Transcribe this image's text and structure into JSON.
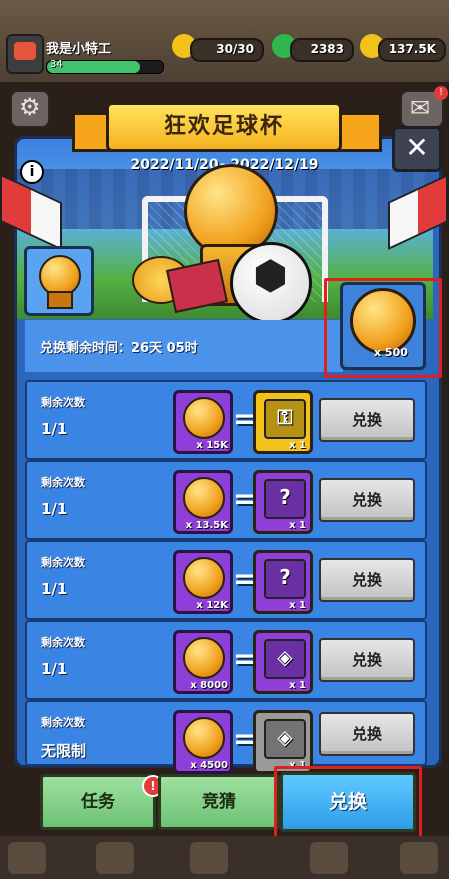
{
  "player": {
    "name": "我是小特工",
    "level": "34",
    "level_progress": 0.8
  },
  "resources": [
    {
      "name": "energy-icon",
      "color": "#f2c21b",
      "value": "30/30"
    },
    {
      "name": "gem-icon",
      "color": "#2fb84c",
      "value": "2383"
    },
    {
      "name": "coin-icon",
      "color": "#f2c21b",
      "value": "137.5K"
    }
  ],
  "mail_badge": "!",
  "event": {
    "title": "狂欢足球杯",
    "dates": "2022/11/20~2022/12/19",
    "info_icon": "i",
    "close_label": "✕",
    "remaining_time": "兑换剩余时间：26天 05时",
    "owned_quantity": "x 500"
  },
  "rows": [
    {
      "label": "剩余次数",
      "count": "1/1",
      "cost": "x 15K",
      "reward_color": "#f2c21b",
      "reward_icon": "⚿",
      "reward_qty": "x 1",
      "button": "兑换"
    },
    {
      "label": "剩余次数",
      "count": "1/1",
      "cost": "x 13.5K",
      "reward_color": "#8e3fd8",
      "reward_icon": "?",
      "reward_qty": "x 1",
      "button": "兑换"
    },
    {
      "label": "剩余次数",
      "count": "1/1",
      "cost": "x 12K",
      "reward_color": "#8e3fd8",
      "reward_icon": "?",
      "reward_qty": "x 1",
      "button": "兑换"
    },
    {
      "label": "剩余次数",
      "count": "1/1",
      "cost": "x 8000",
      "reward_color": "#8e3fd8",
      "reward_icon": "◈",
      "reward_qty": "x 1",
      "button": "兑换"
    },
    {
      "label": "剩余次数",
      "count": "无限制",
      "cost": "x 4500",
      "reward_color": "#9a9a9a",
      "reward_icon": "◈",
      "reward_qty": "x 1",
      "button": "兑换"
    }
  ],
  "tabs": [
    {
      "label": "任务",
      "badge": "!"
    },
    {
      "label": "竞猜"
    },
    {
      "label": "兑换"
    }
  ]
}
